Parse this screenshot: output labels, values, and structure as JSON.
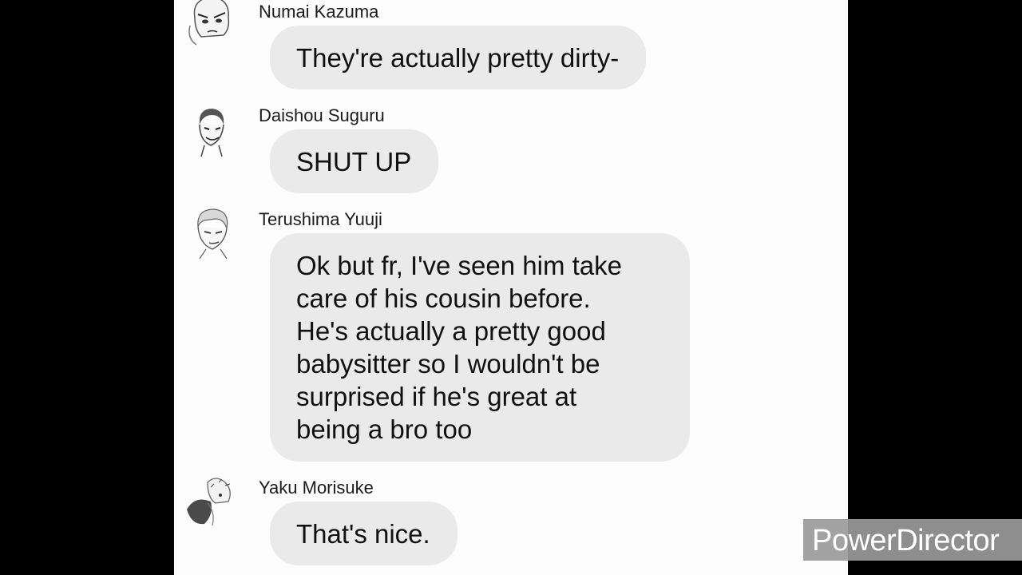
{
  "watermark": {
    "text": "PowerDirector"
  },
  "chat": {
    "messages": [
      {
        "sender": "Numai Kazuma",
        "lines": [
          "They're actually pretty dirty-"
        ],
        "avatar_icon": "numai-avatar-icon"
      },
      {
        "sender": "Daishou Suguru",
        "lines": [
          "SHUT UP"
        ],
        "avatar_icon": "daishou-avatar-icon"
      },
      {
        "sender": "Terushima Yuuji",
        "lines": [
          "Ok but fr, I've seen him take",
          "care of his cousin before.",
          "He's actually a pretty good",
          "babysitter so I wouldn't be",
          "surprised if he's great at",
          "being a bro too"
        ],
        "avatar_icon": "terushima-avatar-icon"
      },
      {
        "sender": "Yaku Morisuke",
        "lines": [
          "That's nice."
        ],
        "avatar_icon": "yaku-avatar-icon"
      }
    ]
  }
}
